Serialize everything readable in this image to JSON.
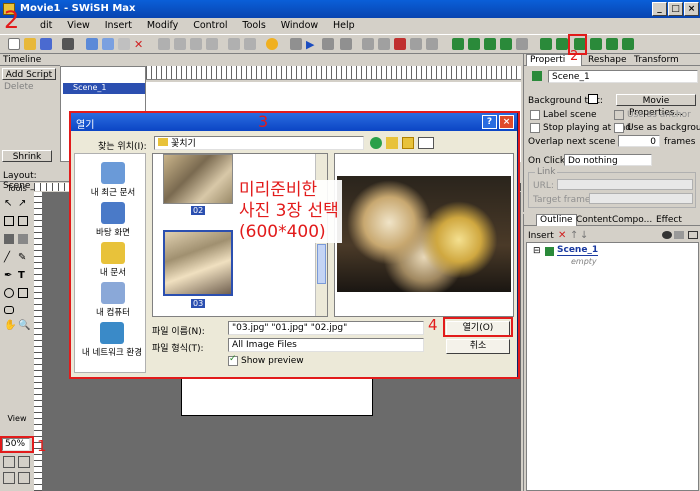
{
  "window": {
    "title": "Movie1 - SWiSH Max",
    "min": "_",
    "max": "□",
    "close": "×"
  },
  "menu": [
    "dit",
    "View",
    "Insert",
    "Modify",
    "Control",
    "Tools",
    "Window",
    "Help"
  ],
  "timeline": {
    "title": "Timeline",
    "add_script": "Add Script",
    "delete": "Delete",
    "scene_label": "Scene_1",
    "shrink": "Shrink"
  },
  "layout": {
    "tab": "Layout: Scene_",
    "tools_label": "Tools",
    "view_label": "View",
    "zoom": "50%"
  },
  "properties": {
    "tabs": [
      "Properti",
      "Reshape",
      "Transform"
    ],
    "scene_name": "Scene_1",
    "bg_tint": "Background tint:",
    "movie_props_btn": "Movie Properties...",
    "label_scene": "Label scene",
    "use_as_anchor": "Use as anchor",
    "stop_playing": "Stop playing at end",
    "use_as_bg": "Use as background",
    "overlap": "Overlap next scene by:",
    "overlap_value": "0",
    "frames": "frames",
    "on_click": "On Click:",
    "on_click_value": "Do nothing",
    "link_group": "Link",
    "url": "URL:",
    "target_frame": "Target frame:"
  },
  "outline": {
    "tabs": [
      "Outline",
      "Content",
      "Compo...",
      "Effect"
    ],
    "insert": "Insert",
    "scene": "Scene_1",
    "empty": "empty"
  },
  "dialog": {
    "title": "열기",
    "look_in_label": "찾는 위치(I):",
    "look_in_value": "꽃치기",
    "places": [
      "내 최근 문서",
      "바탕 화면",
      "내 문서",
      "내 컴퓨터",
      "내 네트워크 환경"
    ],
    "thumb1": "02",
    "thumb2": "03",
    "filename_label": "파일 이름(N):",
    "filename_value": "\"03.jpg\" \"01.jpg\" \"02.jpg\"",
    "filetype_label": "파일 형식(T):",
    "filetype_value": "All Image Files",
    "show_preview": "Show preview",
    "open_btn": "열기(O)",
    "cancel_btn": "취소",
    "help_btn": "?",
    "close_btn": "×"
  },
  "annotations": {
    "n2_top": "2",
    "n2_toolbar": "2",
    "n3": "3",
    "n4": "4",
    "n1": "1",
    "korean_note": [
      "미리준비한",
      "사진 3장 선택",
      "(600*400)"
    ]
  },
  "colors": {
    "annotation": "#e21b1b",
    "titlebar": "#0a5fd8",
    "stage": "#6b6b6b"
  }
}
